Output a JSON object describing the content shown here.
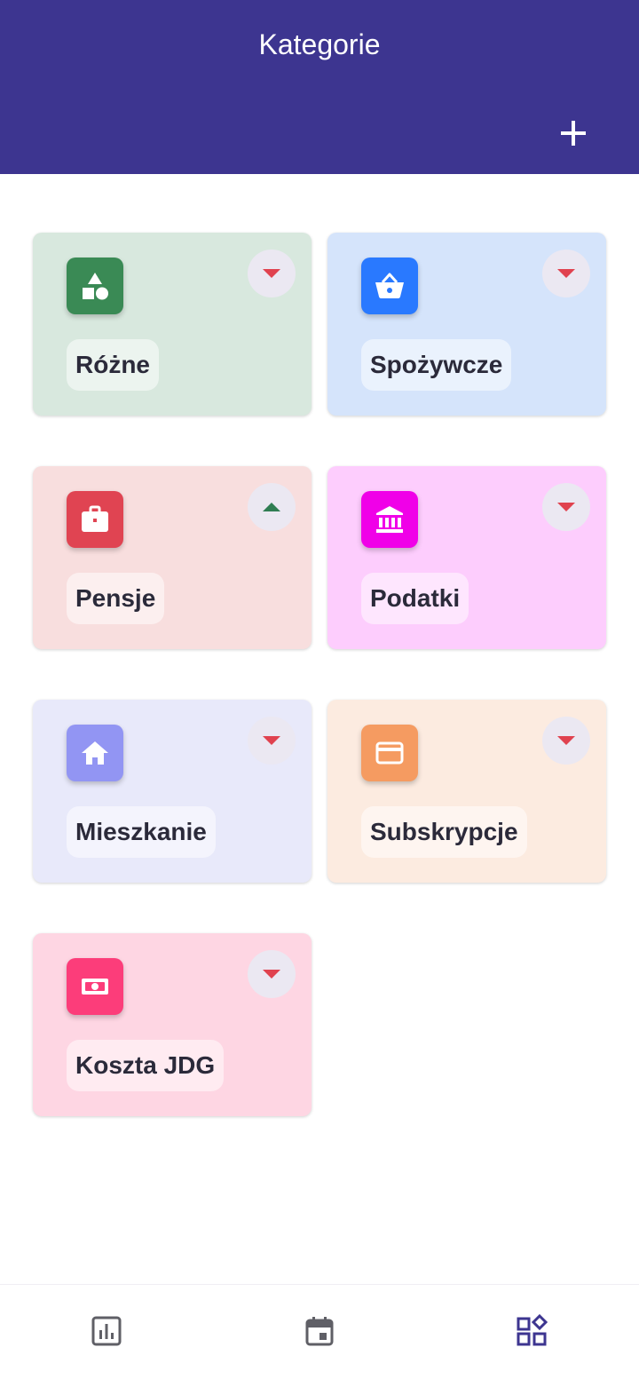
{
  "header": {
    "title": "Kategorie",
    "add_icon": "plus-icon"
  },
  "colors": {
    "header_bg": "#3d3590",
    "arrow_down": "#e0424f",
    "arrow_up": "#2f7d52",
    "nav_inactive": "#5f5f66",
    "nav_active": "#3d3590"
  },
  "categories": [
    {
      "label": "Różne",
      "icon": "shapes-icon",
      "card_bg": "#d8e8de",
      "icon_bg": "#3a8a55",
      "toggle": "down"
    },
    {
      "label": "Spożywcze",
      "icon": "basket-icon",
      "card_bg": "#d5e4fb",
      "icon_bg": "#2979ff",
      "toggle": "down"
    },
    {
      "label": "Pensje",
      "icon": "briefcase-icon",
      "card_bg": "#f8dede",
      "icon_bg": "#e04452",
      "toggle": "up"
    },
    {
      "label": "Podatki",
      "icon": "bank-icon",
      "card_bg": "#fdcdfd",
      "icon_bg": "#f000e8",
      "toggle": "down"
    },
    {
      "label": "Mieszkanie",
      "icon": "home-icon",
      "card_bg": "#e8e9fa",
      "icon_bg": "#9295f3",
      "toggle": "down"
    },
    {
      "label": "Subskrypcje",
      "icon": "credit-card-icon",
      "card_bg": "#fcebe0",
      "icon_bg": "#f59b61",
      "toggle": "down"
    },
    {
      "label": "Koszta JDG",
      "icon": "money-icon",
      "card_bg": "#fed6e3",
      "icon_bg": "#fc3d7a",
      "toggle": "down"
    }
  ],
  "bottom_nav": [
    {
      "icon": "chart-icon",
      "active": false
    },
    {
      "icon": "calendar-icon",
      "active": false
    },
    {
      "icon": "categories-icon",
      "active": true
    }
  ]
}
